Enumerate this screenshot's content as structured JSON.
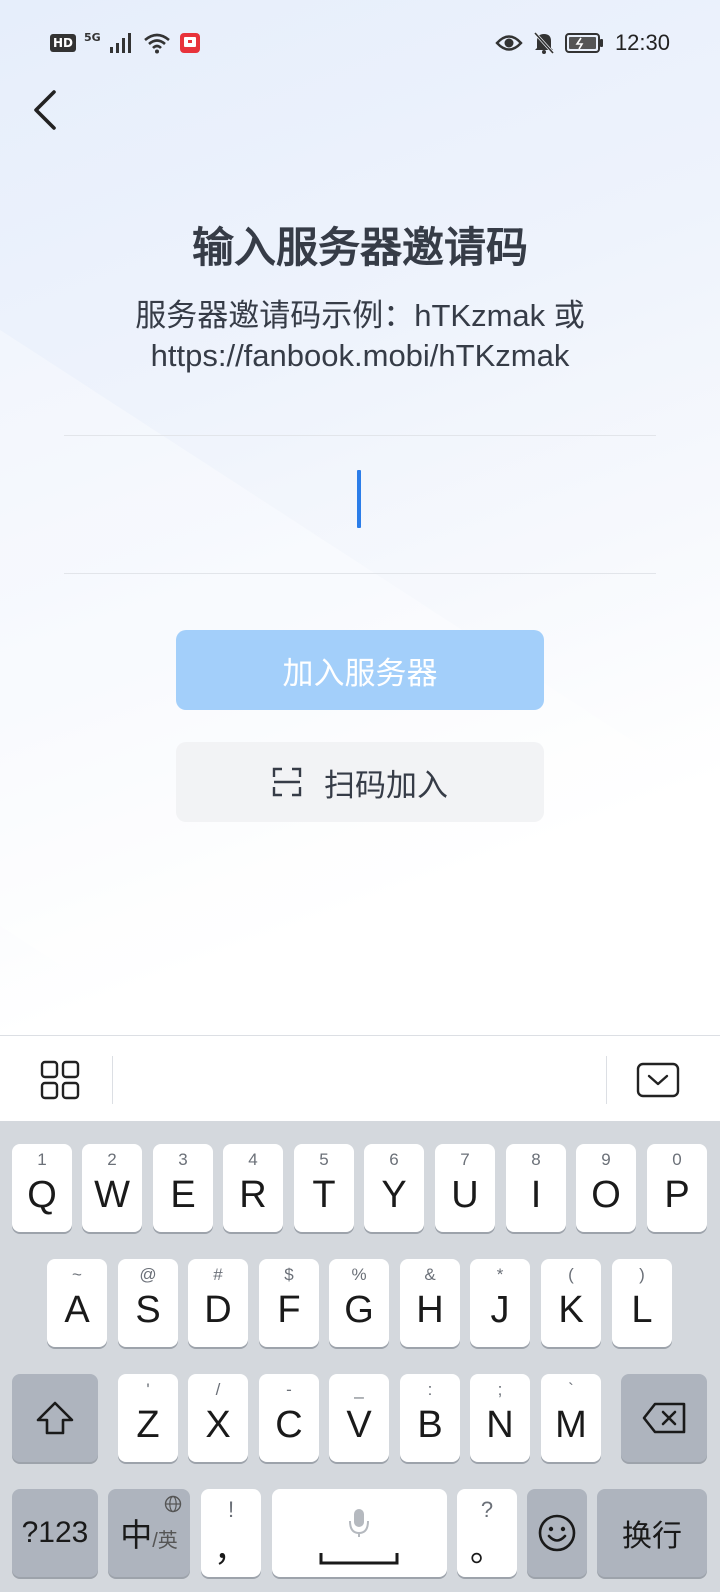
{
  "status_bar": {
    "hd": "HD",
    "network": "5G",
    "time": "12:30"
  },
  "page": {
    "title": "输入服务器邀请码",
    "hint_line1": "服务器邀请码示例：hTKzmak 或",
    "hint_line2": "https://fanbook.mobi/hTKzmak",
    "input_value": "",
    "join_button": "加入服务器",
    "scan_button": "扫码加入"
  },
  "colors": {
    "accent": "#2b7de9",
    "join_disabled": "#a3cffa",
    "scan_bg": "#f2f3f5",
    "title": "#363c47"
  },
  "keyboard": {
    "row1": [
      {
        "sub": "1",
        "main": "Q"
      },
      {
        "sub": "2",
        "main": "W"
      },
      {
        "sub": "3",
        "main": "E"
      },
      {
        "sub": "4",
        "main": "R"
      },
      {
        "sub": "5",
        "main": "T"
      },
      {
        "sub": "6",
        "main": "Y"
      },
      {
        "sub": "7",
        "main": "U"
      },
      {
        "sub": "8",
        "main": "I"
      },
      {
        "sub": "9",
        "main": "O"
      },
      {
        "sub": "0",
        "main": "P"
      }
    ],
    "row2": [
      {
        "sub": "~",
        "main": "A"
      },
      {
        "sub": "@",
        "main": "S"
      },
      {
        "sub": "#",
        "main": "D"
      },
      {
        "sub": "$",
        "main": "F"
      },
      {
        "sub": "%",
        "main": "G"
      },
      {
        "sub": "&",
        "main": "H"
      },
      {
        "sub": "*",
        "main": "J"
      },
      {
        "sub": "(",
        "main": "K"
      },
      {
        "sub": ")",
        "main": "L"
      }
    ],
    "row3": [
      {
        "sub": "'",
        "main": "Z"
      },
      {
        "sub": "/",
        "main": "X"
      },
      {
        "sub": "-",
        "main": "C"
      },
      {
        "sub": "_",
        "main": "V"
      },
      {
        "sub": ":",
        "main": "B"
      },
      {
        "sub": ";",
        "main": "N"
      },
      {
        "sub": "`",
        "main": "M"
      }
    ],
    "numbers_key": "?123",
    "lang_key_main": "中",
    "lang_key_sub": "/英",
    "comma_key_sub": "!",
    "comma_key_main": "，",
    "period_key_sub": "?",
    "period_key_main": "。",
    "enter_key": "换行"
  },
  "icons": {
    "back": "chevron-left-icon",
    "scan": "scan-icon",
    "toolbar_menu": "grid-icon",
    "toolbar_hide": "keyboard-hide-icon",
    "shift": "shift-icon",
    "delete": "backspace-icon",
    "mic": "microphone-icon",
    "emoji": "emoji-icon",
    "globe": "globe-icon"
  }
}
